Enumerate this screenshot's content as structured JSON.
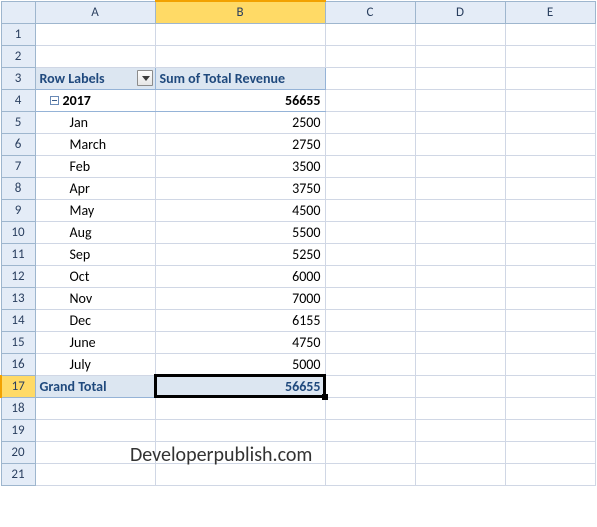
{
  "columns": [
    "A",
    "B",
    "C",
    "D",
    "E"
  ],
  "rowCount": 21,
  "selectedCol": "B",
  "selectedRow": 17,
  "activeCell": "B17",
  "pivot": {
    "header": {
      "row_labels": "Row Labels",
      "value_label": "Sum of Total Revenue"
    },
    "group": {
      "name": "2017",
      "subtotal": 56655
    },
    "items": [
      {
        "label": "Jan",
        "value": 2500
      },
      {
        "label": "March",
        "value": 2750
      },
      {
        "label": "Feb",
        "value": 3500
      },
      {
        "label": "Apr",
        "value": 3750
      },
      {
        "label": "May",
        "value": 4500
      },
      {
        "label": "Aug",
        "value": 5500
      },
      {
        "label": "Sep",
        "value": 5250
      },
      {
        "label": "Oct",
        "value": 6000
      },
      {
        "label": "Nov",
        "value": 7000
      },
      {
        "label": "Dec",
        "value": 6155
      },
      {
        "label": "June",
        "value": 4750
      },
      {
        "label": "July",
        "value": 5000
      }
    ],
    "grand_total": {
      "label": "Grand Total",
      "value": 56655
    }
  },
  "watermark": "Developerpublish.com"
}
